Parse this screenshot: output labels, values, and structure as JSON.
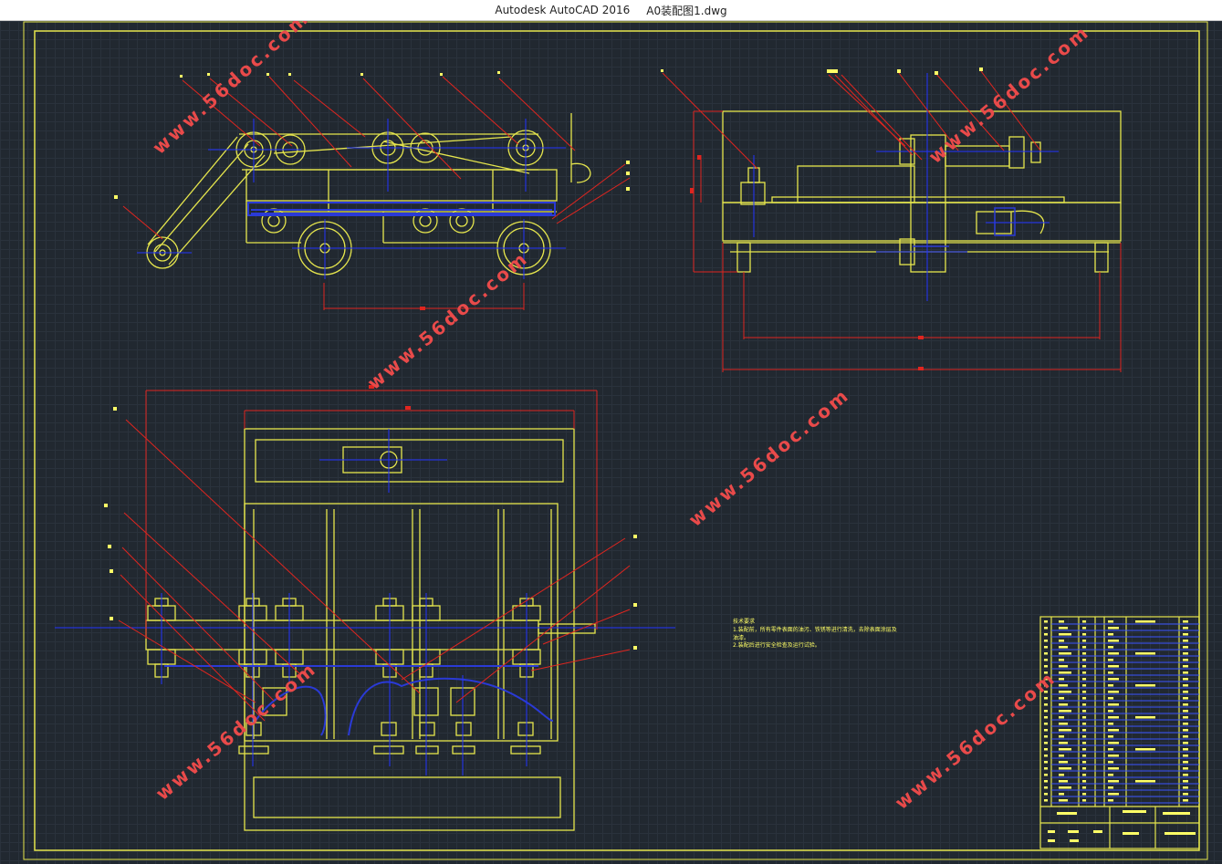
{
  "window": {
    "app_title": "Autodesk AutoCAD 2016",
    "file_name": "A0装配图1.dwg"
  },
  "watermark": {
    "text": "www.56doc.com",
    "color": "#e94a4a"
  },
  "tech_notes": {
    "heading": "技术要求",
    "line1": "1.装配前，所有零件表面的油污、铁锈等进行清洗，去除表面涂层及",
    "line2": "油漆。",
    "line3": "2.装配后进行安全检查及运行试验。"
  },
  "colors": {
    "background": "#212830",
    "outline": "#e6e64d",
    "hidden": "#2a3ad6",
    "dimension": "#e0251f",
    "center": "#2233ff"
  }
}
